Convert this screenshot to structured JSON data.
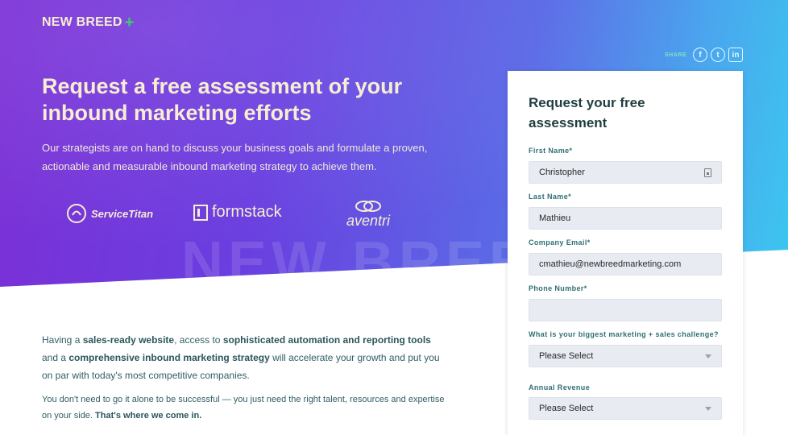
{
  "brand": {
    "name": "NEW BREED",
    "plus": "+"
  },
  "share": {
    "label": "SHARE",
    "icons": [
      "facebook-icon",
      "twitter-icon",
      "linkedin-icon"
    ],
    "facebook_glyph": "f",
    "twitter_glyph": "t",
    "linkedin_glyph": "in"
  },
  "hero": {
    "headline": "Request a free assessment of your inbound marketing efforts",
    "subhead": "Our strategists are on hand to discuss your business goals and formulate a proven, actionable and measurable inbound marketing strategy to achieve them.",
    "watermark": "NEW BREED",
    "client_logos": {
      "servicetitan": "ServiceTitan",
      "formstack": "formstack",
      "aventri": "aventri"
    }
  },
  "body": {
    "p1": {
      "t1": "Having a ",
      "b1": "sales-ready website",
      "t2": ", access to ",
      "b2": "sophisticated automation and reporting tools",
      "t3": " and a ",
      "b3": "comprehensive inbound marketing strategy",
      "t4": " will accelerate your growth and put you on par with today's most competitive companies."
    },
    "p2": {
      "t1": "You don't need to go it alone to be successful — you just need the right talent, resources and expertise on your side. ",
      "b1": "That's where we come in."
    }
  },
  "form": {
    "title": "Request your free assessment",
    "fields": [
      {
        "label": "First Name*",
        "value": "Christopher"
      },
      {
        "label": "Last Name*",
        "value": "Mathieu"
      },
      {
        "label": "Company Email*",
        "value": "cmathieu@newbreedmarketing.com"
      },
      {
        "label": "Phone Number*",
        "value": ""
      },
      {
        "label": "What is your biggest marketing + sales challenge?",
        "value": "Please Select"
      },
      {
        "label": "Annual Revenue",
        "value": "Please Select"
      }
    ]
  },
  "colors": {
    "accent": "#3ccf6a",
    "heading_cream": "#f6edd2",
    "teal_text": "#2f6f74"
  }
}
